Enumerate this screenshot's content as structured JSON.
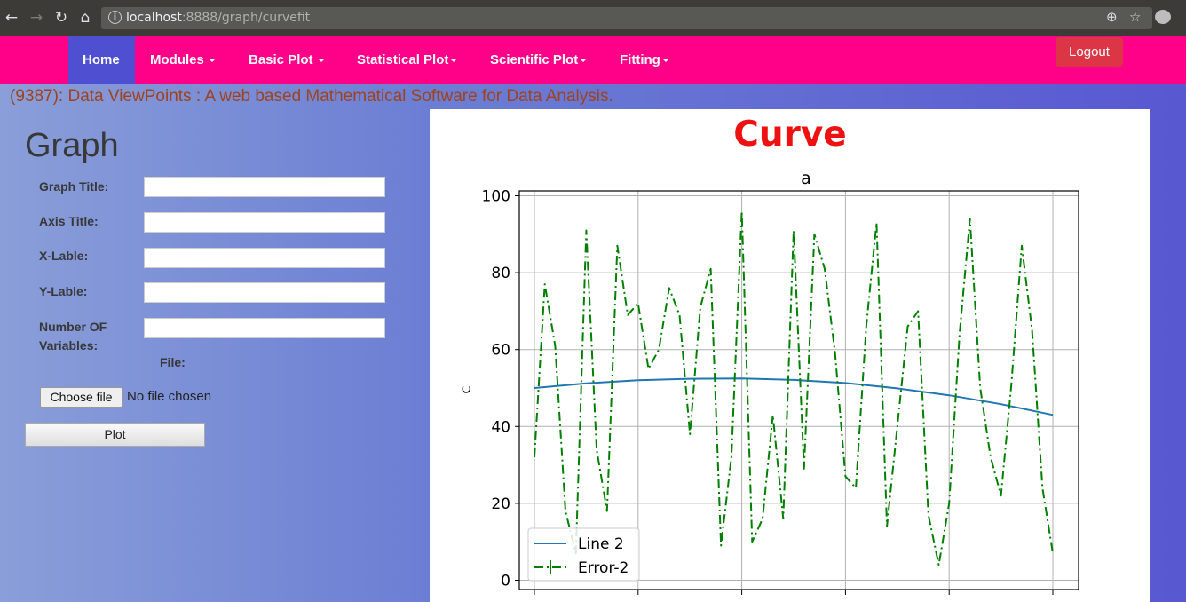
{
  "browser": {
    "url_host": "localhost",
    "url_rest": ":8888/graph/curvefit"
  },
  "navbar": {
    "items": [
      {
        "label": "Home",
        "dropdown": false
      },
      {
        "label": "Modules",
        "dropdown": true
      },
      {
        "label": "Basic Plot",
        "dropdown": true
      },
      {
        "label": "Statistical Plot",
        "dropdown": true
      },
      {
        "label": "Scientific Plot",
        "dropdown": true
      },
      {
        "label": "Fitting",
        "dropdown": true
      }
    ],
    "logout": "Logout",
    "colors": {
      "bar": "#ff0088",
      "active": "#4f4fd1",
      "logout": "#dc3545"
    }
  },
  "tagline": "(9387): Data ViewPoints : A web based Mathematical Software for Data Analysis.",
  "form": {
    "heading": "Graph",
    "graph_title_label": "Graph Title:",
    "axis_title_label": "Axis Title:",
    "xlabel_label": "X-Lable:",
    "ylabel_label": "Y-Lable:",
    "num_vars_label": "Number OF Variables:",
    "file_label": "File:",
    "choose_file": "Choose file",
    "no_file": "No file chosen",
    "plot_button": "Plot"
  },
  "chart_heading": "Curve",
  "chart_data": {
    "type": "line",
    "title": "a",
    "xlabel": "",
    "ylabel": "c",
    "ylim": [
      0,
      100
    ],
    "yticks": [
      "0",
      "20",
      "40",
      "60",
      "80",
      "100"
    ],
    "xlim": [
      0,
      100
    ],
    "grid": true,
    "legend_position": "lower-left",
    "series": [
      {
        "name": "Line 2",
        "style": "solid",
        "color": "#1f77b4",
        "x": [
          0,
          10,
          20,
          30,
          40,
          50,
          60,
          70,
          80,
          90,
          100
        ],
        "y": [
          50,
          51.2,
          52,
          52.4,
          52.5,
          52.1,
          51.3,
          49.9,
          48.1,
          45.8,
          43
        ]
      },
      {
        "name": "Error-2",
        "style": "dashdot",
        "color": "#008000",
        "x": [
          0,
          2,
          4,
          6,
          8,
          10,
          12,
          14,
          16,
          18,
          20,
          22,
          24,
          26,
          28,
          30,
          32,
          34,
          36,
          38,
          40,
          42,
          44,
          46,
          48,
          50,
          52,
          54,
          56,
          58,
          60,
          62,
          64,
          66,
          68,
          70,
          72,
          74,
          76,
          78,
          80,
          82,
          84,
          86,
          88,
          90,
          92,
          94,
          96,
          98,
          100
        ],
        "y": [
          32,
          77,
          61,
          18,
          7,
          91,
          34,
          18,
          87,
          69,
          72,
          55,
          60,
          76,
          69,
          38,
          71,
          81,
          9,
          32,
          96,
          10,
          16,
          43,
          16,
          91,
          29,
          90,
          81,
          59,
          27,
          24,
          66,
          93,
          14,
          40,
          66,
          70,
          17,
          4,
          20,
          64,
          94,
          50,
          32,
          22,
          51,
          87,
          65,
          24,
          7
        ]
      }
    ]
  }
}
